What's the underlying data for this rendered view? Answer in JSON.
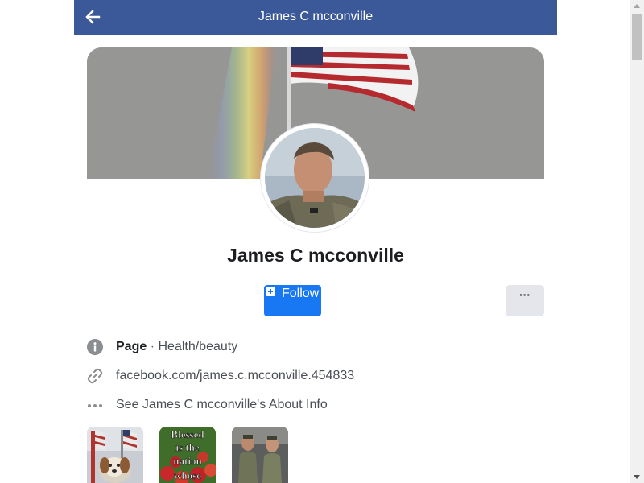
{
  "header": {
    "title": "James C mcconville"
  },
  "profile": {
    "name": "James C mcconville"
  },
  "actions": {
    "follow_label": "Follow",
    "more_label": "···"
  },
  "info": {
    "category_prefix": "Page",
    "category_separator": "·",
    "category_value": "Health/beauty",
    "link": "facebook.com/james.c.mcconville.454833",
    "about": "See James C mcconville's About Info"
  },
  "photos": [
    {
      "icon": "flag-dog-photo"
    },
    {
      "icon": "blessed-nation-photo",
      "text_lines": [
        "Blessed",
        "is  the",
        "nation",
        "whose"
      ]
    },
    {
      "icon": "soldiers-photo"
    }
  ],
  "colors": {
    "header_bg": "#3b5998",
    "follow_bg": "#1877f2",
    "more_bg": "#e4e6eb"
  }
}
